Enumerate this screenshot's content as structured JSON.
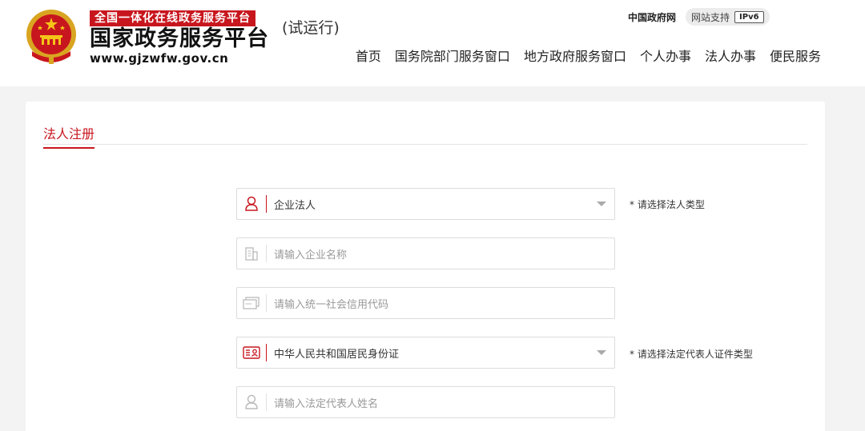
{
  "header": {
    "banner": "全国一体化在线政务服务平台",
    "title": "国家政务服务平台",
    "url": "www.gjzwfw.gov.cn",
    "trial": "(试运行)",
    "gov_link": "中国政府网",
    "support_label": "网站支持",
    "ipv6_badge": "IPv6",
    "nav": [
      {
        "label": "首页"
      },
      {
        "label": "国务院部门服务窗口"
      },
      {
        "label": "地方政府服务窗口"
      },
      {
        "label": "个人办事"
      },
      {
        "label": "法人办事"
      },
      {
        "label": "便民服务"
      }
    ]
  },
  "form": {
    "section_title": "法人注册",
    "legal_type": {
      "value": "企业法人",
      "hint": "* 请选择法人类型",
      "icon": "user-outline-icon"
    },
    "company_name": {
      "placeholder": "请输入企业名称",
      "icon": "building-icon"
    },
    "credit_code": {
      "placeholder": "请输入统一社会信用代码",
      "icon": "card-stack-icon"
    },
    "id_type": {
      "value": "中华人民共和国居民身份证",
      "hint": "* 请选择法定代表人证件类型",
      "icon": "id-card-icon"
    },
    "rep_name": {
      "placeholder": "请输入法定代表人姓名",
      "icon": "user-outline-icon"
    }
  },
  "colors": {
    "accent": "#c8161e",
    "background": "#f3f3f3"
  }
}
